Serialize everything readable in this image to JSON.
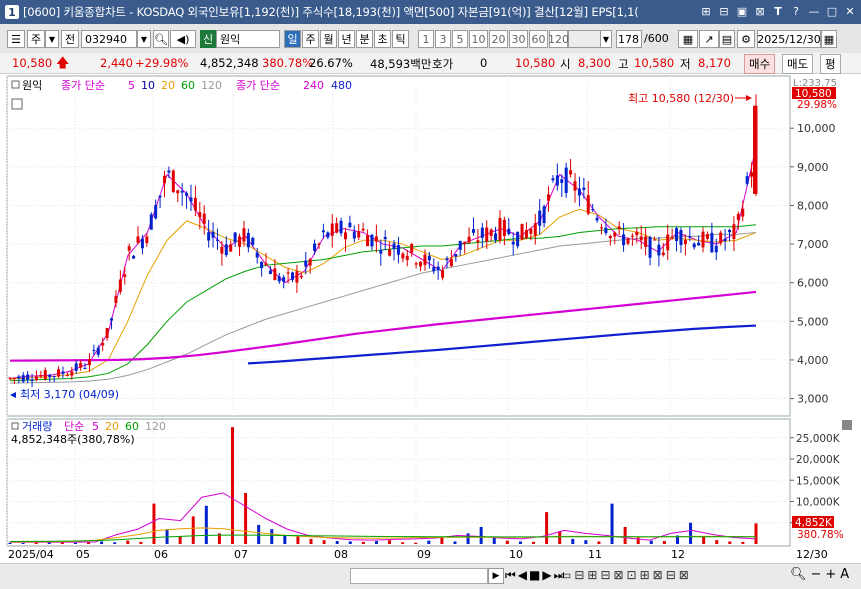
{
  "window": {
    "number": "1",
    "title": "[0600] 키움종합차트 - KOSDAQ 외국인보유[1,192(천)] 주식수[18,193(천)] 액면[500] 자본금[91(억)] 결산[12월] EPS[1,1("
  },
  "toolbar": {
    "type_label": "주",
    "prev_label": "전",
    "stock_code": "032940",
    "credit_badge": "신",
    "stock_name": "원익",
    "periods": [
      "일",
      "주",
      "월",
      "년",
      "분",
      "초",
      "틱"
    ],
    "active_period": "일",
    "intervals": [
      "1",
      "3",
      "5",
      "10",
      "20",
      "30",
      "60",
      "120"
    ],
    "count": "178",
    "count_total": "/600",
    "date": "2025/12/30"
  },
  "quote": {
    "price": "10,580",
    "arrow": "up-arrow-icon",
    "change": "2,440",
    "change_rate": "+29.98%",
    "volume": "4,852,348",
    "volume_ratio": "380.78%",
    "turnover": "26.67%",
    "amount": "48,593백만",
    "bid_label": "호가",
    "bid_value": "0",
    "bid_price": "10,580",
    "open_label": "시",
    "open": "8,300",
    "high_label": "고",
    "high": "10,580",
    "low_label": "저",
    "low": "8,170",
    "buy_label": "매수",
    "sell_label": "매도",
    "eval_label": "평"
  },
  "legends": {
    "price_name": "원익",
    "ma_title": "종가 단순",
    "ma_periods_a": [
      "5",
      "10",
      "20",
      "60",
      "120"
    ],
    "ma_title2": "종가 단순",
    "ma_periods_b": [
      "240",
      "480"
    ],
    "volume_title": "거래량",
    "volume_ma_title": "단순",
    "volume_ma_periods": [
      "5",
      "20",
      "60",
      "120"
    ],
    "volume_value": "4,852,348주(380,78%)"
  },
  "annotations": {
    "high": "최고 10,580 (12/30)",
    "low": "최저 3,170 (04/09)"
  },
  "right_axis": {
    "top_label": "L:233.75",
    "price_tag": "10,580",
    "rate_tag": "29.98%",
    "vol_tag": "4,852K",
    "vol_rate_tag": "380.78%"
  },
  "x_axis": {
    "labels": [
      "2025/04",
      "05",
      "06",
      "07",
      "08",
      "09",
      "10",
      "11",
      "12"
    ],
    "end_label": "12/30"
  },
  "colors": {
    "up": "#e00000",
    "down": "#0022cc",
    "ma5": "#d400d4",
    "ma10": "#0000a0",
    "ma20": "#e6a000",
    "ma60": "#00a000",
    "ma120": "#9a9a9a",
    "ma240": "#d400d4",
    "ma480": "#1020d0"
  },
  "chart_data": [
    {
      "type": "candlestick",
      "title": "원익",
      "ylim": [
        2600,
        11300
      ],
      "yticks": [
        "3,000",
        "4,000",
        "5,000",
        "6,000",
        "7,000",
        "8,000",
        "9,000",
        "10,000"
      ],
      "x": [
        "2025/04",
        "05",
        "06",
        "07",
        "08",
        "09",
        "10",
        "11",
        "12"
      ],
      "series": [
        {
          "name": "5",
          "values": [
            3520,
            3580,
            3600,
            3700,
            3900,
            4700,
            6700,
            7300,
            8800,
            8300,
            7400,
            6900,
            7200,
            6500,
            6000,
            6300,
            7200,
            7400,
            7300,
            7000,
            6900,
            6600,
            6300,
            7000,
            7200,
            7400,
            7200,
            7600,
            8800,
            8400,
            7700,
            7200,
            7100,
            6800,
            7300,
            7100,
            7000,
            7300,
            9500
          ]
        },
        {
          "name": "20",
          "values": [
            3500,
            3540,
            3560,
            3620,
            3700,
            4000,
            5000,
            6200,
            7100,
            7600,
            7400,
            7150,
            7000,
            6700,
            6400,
            6250,
            6500,
            6900,
            7100,
            7100,
            7000,
            6800,
            6600,
            6700,
            6900,
            7100,
            7100,
            7250,
            7700,
            7900,
            7750,
            7400,
            7300,
            7100,
            7150,
            7100,
            7050,
            7100,
            7300
          ]
        },
        {
          "name": "60",
          "values": [
            3460,
            3480,
            3500,
            3520,
            3560,
            3650,
            3900,
            4400,
            5000,
            5500,
            5800,
            6100,
            6300,
            6450,
            6500,
            6550,
            6600,
            6700,
            6800,
            6850,
            6900,
            6950,
            6950,
            7000,
            7050,
            7100,
            7150,
            7150,
            7200,
            7300,
            7350,
            7400,
            7420,
            7450,
            7450,
            7450,
            7450,
            7450,
            7500
          ]
        },
        {
          "name": "120",
          "values": [
            3400,
            3410,
            3420,
            3430,
            3450,
            3500,
            3600,
            3750,
            3950,
            4150,
            4400,
            4650,
            4850,
            5050,
            5200,
            5350,
            5500,
            5650,
            5800,
            5950,
            6100,
            6250,
            6350,
            6450,
            6550,
            6650,
            6750,
            6850,
            6950,
            7000,
            7050,
            7100,
            7150,
            7150,
            7200,
            7200,
            7250,
            7250,
            7300
          ]
        },
        {
          "name": "240",
          "values": [
            3980,
            3985,
            3990,
            3995,
            4000,
            4020,
            4060,
            4120,
            4200,
            4290,
            4380,
            4480,
            4580,
            4680,
            4760,
            4840,
            4920,
            4990,
            5060,
            5130,
            5200,
            5270,
            5340,
            5410,
            5480,
            5550,
            5620,
            5690,
            5760
          ]
        },
        {
          "name": "480",
          "values": [
            3910,
            3960,
            4020,
            4080,
            4140,
            4200,
            4260,
            4330,
            4400,
            4470,
            4540,
            4610,
            4680,
            4740,
            4800,
            4850,
            4890
          ]
        }
      ],
      "high": 10580,
      "low": 3170
    },
    {
      "type": "bar",
      "title": "거래량",
      "ylim": [
        0,
        28000
      ],
      "yticks": [
        "5,000K",
        "10,000K",
        "15,000K",
        "20,000K",
        "25,000K"
      ],
      "x": [
        "2025/04",
        "05",
        "06",
        "07",
        "08",
        "09",
        "10",
        "11",
        "12"
      ],
      "values": [
        300,
        250,
        400,
        350,
        500,
        300,
        450,
        600,
        400,
        800,
        500,
        9500,
        3500,
        1800,
        6500,
        9000,
        2500,
        27500,
        12000,
        4500,
        3500,
        2000,
        1800,
        1200,
        900,
        700,
        600,
        500,
        700,
        900,
        400,
        300,
        800,
        1500,
        600,
        2500,
        4000,
        1500,
        800,
        600,
        500,
        7500,
        3000,
        1200,
        900,
        600,
        9500,
        4000,
        1500,
        800,
        700,
        2000,
        5000,
        1800,
        900,
        600,
        500,
        4852
      ],
      "series": [
        {
          "name": "5",
          "values": [
            400,
            400,
            420,
            430,
            480,
            2200,
            3500,
            6000,
            5500,
            11000,
            12000,
            9000,
            6000,
            3500,
            2000,
            1400,
            1000,
            900,
            1100,
            1200,
            1400,
            2000,
            1800,
            1400,
            1200,
            1800,
            3200,
            2500,
            2000,
            1400,
            900,
            2500,
            3200,
            2200,
            1500,
            1200
          ]
        },
        {
          "name": "20",
          "values": [
            500,
            500,
            520,
            600,
            900,
            1500,
            2200,
            3200,
            3600,
            3800,
            3600,
            3000,
            2500,
            2000,
            1700,
            1500,
            1400,
            1350,
            1400,
            1500,
            1550,
            1600,
            1600,
            1600,
            1600,
            1650,
            1800,
            1800,
            1750,
            1700,
            1650,
            1700,
            1800,
            1800,
            1750,
            1700
          ]
        },
        {
          "name": "60",
          "values": [
            600,
            620,
            650,
            700,
            800,
            1000,
            1300,
            1600,
            1800,
            2000,
            2100,
            2100,
            2050,
            2000,
            1950,
            1900,
            1850,
            1800,
            1750,
            1750,
            1720,
            1700,
            1700,
            1680,
            1680,
            1680,
            1700,
            1700,
            1700,
            1700,
            1700,
            1700,
            1700,
            1700,
            1700,
            1700
          ]
        }
      ]
    }
  ]
}
